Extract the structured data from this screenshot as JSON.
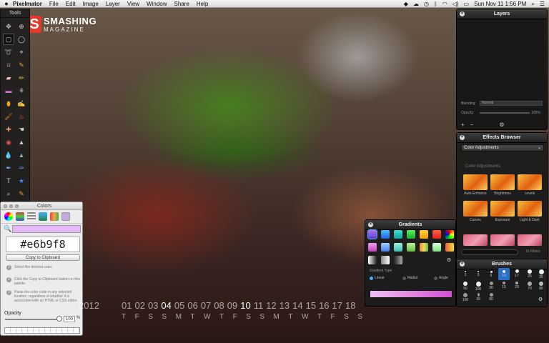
{
  "menubar": {
    "apple": "",
    "app": "Pixelmator",
    "items": [
      "File",
      "Edit",
      "Image",
      "Layer",
      "View",
      "Window",
      "Share",
      "Help"
    ],
    "clock": "Sun Nov 11  1:56 PM"
  },
  "logo": {
    "mark": "S",
    "title": "SMASHING",
    "sub": "MAGAZINE"
  },
  "tools": {
    "title": "Tools"
  },
  "colors": {
    "title": "Colors",
    "hex": "#e6b9f8",
    "copy": "Copy to Clipboard",
    "steps": [
      "Select the desired color.",
      "Click the Copy to Clipboard button on this palette.",
      "Paste the color code in any selected location, regardless of whether it is associated with an HTML or CSS editor."
    ],
    "opacity_label": "Opacity",
    "opacity": "100",
    "pct": "%"
  },
  "calendar": {
    "year": "2012",
    "days": [
      "01",
      "02",
      "03",
      "04",
      "05",
      "06",
      "07",
      "08",
      "09",
      "10",
      "11",
      "12",
      "13",
      "14",
      "15",
      "16",
      "17",
      "18"
    ],
    "weekdays": [
      "T",
      "F",
      "S",
      "S",
      "M",
      "T",
      "W",
      "T",
      "F",
      "S",
      "S",
      "M",
      "T",
      "W",
      "T",
      "F",
      "S",
      "S"
    ]
  },
  "layers": {
    "title": "Layers",
    "blending_label": "Blending:",
    "blending": "Normal",
    "opacity_label": "Opacity:",
    "opacity": "100%"
  },
  "effects": {
    "title": "Effects Browser",
    "category": "Color Adjustments",
    "section": "Color Adjustments",
    "items": [
      "Auto Enhance",
      "Brightness",
      "Levels",
      "Curves",
      "Exposure",
      "Light & Dark"
    ],
    "count": "15 Filters"
  },
  "gradients": {
    "title": "Gradients",
    "type_label": "Gradient Type",
    "types": [
      "Linear",
      "Radial",
      "Angle"
    ]
  },
  "brushes": {
    "title": "Brushes",
    "sizes": [
      "1",
      "3",
      "5",
      "10",
      "17",
      "25",
      "35",
      "50",
      "100",
      "30",
      "15",
      "20",
      "70",
      "80",
      "100",
      "30",
      "80"
    ]
  },
  "accent": "#e6b9f8"
}
